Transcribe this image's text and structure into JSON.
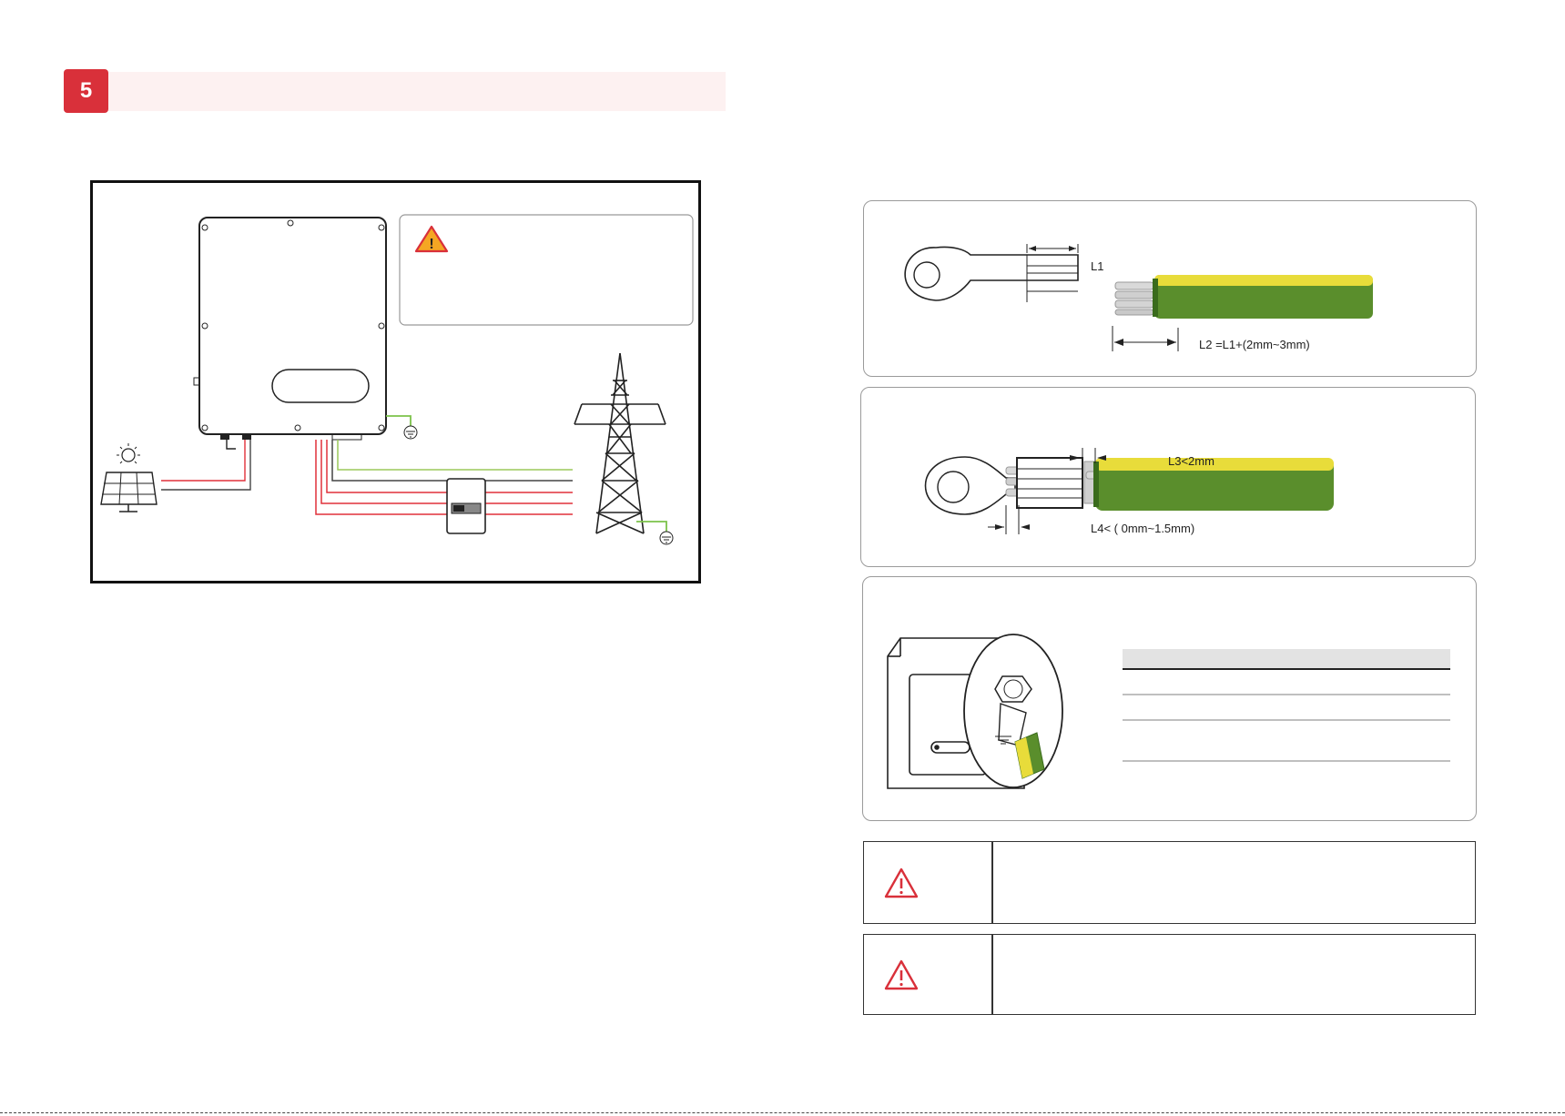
{
  "section": {
    "number": "5"
  },
  "dimensions": {
    "l1": "L1",
    "l2": "L2 =L1+(2mm~3mm)",
    "l3": "L3<2mm",
    "l4": "L4< ( 0mm~1.5mm)"
  },
  "icons": {
    "warning": "warning-triangle-icon",
    "sun": "sun-icon",
    "solar_panel": "solar-panel-icon",
    "inverter": "inverter-icon",
    "breaker": "breaker-icon",
    "grid_tower": "transmission-tower-icon",
    "ground": "ground-icon",
    "ring_terminal": "ring-terminal-icon",
    "cable": "ground-cable-icon"
  },
  "colors": {
    "accent": "#d9303a",
    "section_bar": "#fdf1f1",
    "cable_green": "#5a8e2c",
    "cable_yellow": "#e8dc3a",
    "wire_red": "#e0303a",
    "wire_green": "#7cc24a"
  }
}
